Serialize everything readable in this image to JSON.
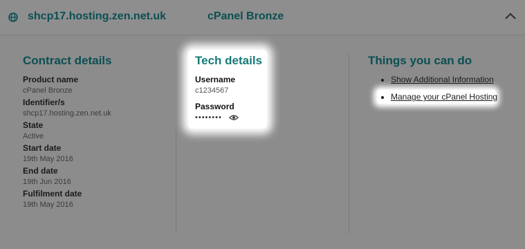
{
  "header": {
    "server_name": "shcp17.hosting.zen.net.uk",
    "product": "cPanel Bronze",
    "globe_icon": "globe-icon",
    "collapse_icon": "chevron-up-icon"
  },
  "contract": {
    "title": "Contract details",
    "fields": [
      {
        "label": "Product name",
        "value": "cPanel Bronze"
      },
      {
        "label": "Identifier/s",
        "value": "shcp17.hosting.zen.net.uk"
      },
      {
        "label": "State",
        "value": "Active"
      },
      {
        "label": "Start date",
        "value": "19th May 2016"
      },
      {
        "label": "End date",
        "value": "19th Jun 2016"
      },
      {
        "label": "Fulfilment date",
        "value": "19th May 2016"
      }
    ]
  },
  "tech": {
    "title": "Tech details",
    "username_label": "Username",
    "username": "c1234567",
    "password_label": "Password",
    "password_masked": "••••••••",
    "reveal_icon": "eye-icon"
  },
  "actions": {
    "title": "Things you can do",
    "items": [
      {
        "label": "Show Additional Information"
      },
      {
        "label": "Manage your cPanel Hosting"
      }
    ]
  },
  "colors": {
    "accent": "#167a79",
    "overlay": "#8c8c8c"
  }
}
